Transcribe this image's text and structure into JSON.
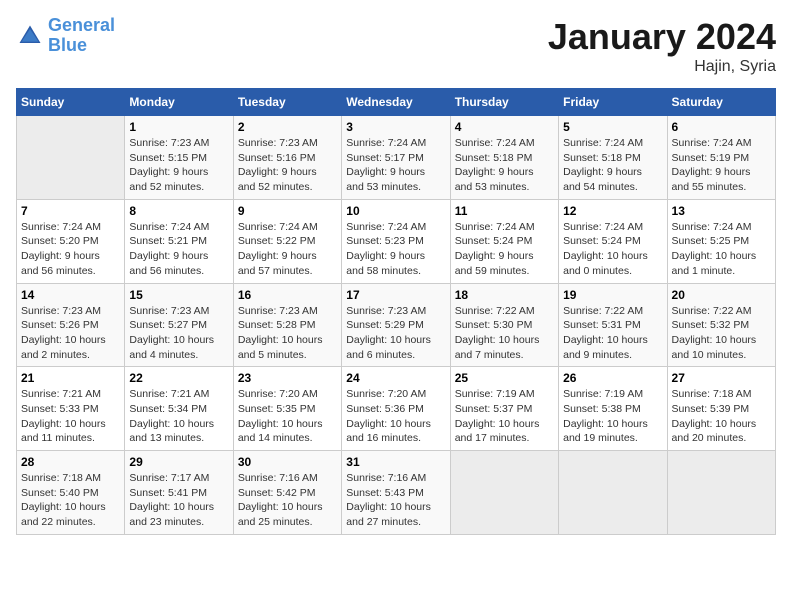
{
  "header": {
    "logo_line1": "General",
    "logo_line2": "Blue",
    "title": "January 2024",
    "subtitle": "Hajin, Syria"
  },
  "columns": [
    "Sunday",
    "Monday",
    "Tuesday",
    "Wednesday",
    "Thursday",
    "Friday",
    "Saturday"
  ],
  "weeks": [
    [
      {
        "day": "",
        "info": ""
      },
      {
        "day": "1",
        "info": "Sunrise: 7:23 AM\nSunset: 5:15 PM\nDaylight: 9 hours\nand 52 minutes."
      },
      {
        "day": "2",
        "info": "Sunrise: 7:23 AM\nSunset: 5:16 PM\nDaylight: 9 hours\nand 52 minutes."
      },
      {
        "day": "3",
        "info": "Sunrise: 7:24 AM\nSunset: 5:17 PM\nDaylight: 9 hours\nand 53 minutes."
      },
      {
        "day": "4",
        "info": "Sunrise: 7:24 AM\nSunset: 5:18 PM\nDaylight: 9 hours\nand 53 minutes."
      },
      {
        "day": "5",
        "info": "Sunrise: 7:24 AM\nSunset: 5:18 PM\nDaylight: 9 hours\nand 54 minutes."
      },
      {
        "day": "6",
        "info": "Sunrise: 7:24 AM\nSunset: 5:19 PM\nDaylight: 9 hours\nand 55 minutes."
      }
    ],
    [
      {
        "day": "7",
        "info": "Sunrise: 7:24 AM\nSunset: 5:20 PM\nDaylight: 9 hours\nand 56 minutes."
      },
      {
        "day": "8",
        "info": "Sunrise: 7:24 AM\nSunset: 5:21 PM\nDaylight: 9 hours\nand 56 minutes."
      },
      {
        "day": "9",
        "info": "Sunrise: 7:24 AM\nSunset: 5:22 PM\nDaylight: 9 hours\nand 57 minutes."
      },
      {
        "day": "10",
        "info": "Sunrise: 7:24 AM\nSunset: 5:23 PM\nDaylight: 9 hours\nand 58 minutes."
      },
      {
        "day": "11",
        "info": "Sunrise: 7:24 AM\nSunset: 5:24 PM\nDaylight: 9 hours\nand 59 minutes."
      },
      {
        "day": "12",
        "info": "Sunrise: 7:24 AM\nSunset: 5:24 PM\nDaylight: 10 hours\nand 0 minutes."
      },
      {
        "day": "13",
        "info": "Sunrise: 7:24 AM\nSunset: 5:25 PM\nDaylight: 10 hours\nand 1 minute."
      }
    ],
    [
      {
        "day": "14",
        "info": "Sunrise: 7:23 AM\nSunset: 5:26 PM\nDaylight: 10 hours\nand 2 minutes."
      },
      {
        "day": "15",
        "info": "Sunrise: 7:23 AM\nSunset: 5:27 PM\nDaylight: 10 hours\nand 4 minutes."
      },
      {
        "day": "16",
        "info": "Sunrise: 7:23 AM\nSunset: 5:28 PM\nDaylight: 10 hours\nand 5 minutes."
      },
      {
        "day": "17",
        "info": "Sunrise: 7:23 AM\nSunset: 5:29 PM\nDaylight: 10 hours\nand 6 minutes."
      },
      {
        "day": "18",
        "info": "Sunrise: 7:22 AM\nSunset: 5:30 PM\nDaylight: 10 hours\nand 7 minutes."
      },
      {
        "day": "19",
        "info": "Sunrise: 7:22 AM\nSunset: 5:31 PM\nDaylight: 10 hours\nand 9 minutes."
      },
      {
        "day": "20",
        "info": "Sunrise: 7:22 AM\nSunset: 5:32 PM\nDaylight: 10 hours\nand 10 minutes."
      }
    ],
    [
      {
        "day": "21",
        "info": "Sunrise: 7:21 AM\nSunset: 5:33 PM\nDaylight: 10 hours\nand 11 minutes."
      },
      {
        "day": "22",
        "info": "Sunrise: 7:21 AM\nSunset: 5:34 PM\nDaylight: 10 hours\nand 13 minutes."
      },
      {
        "day": "23",
        "info": "Sunrise: 7:20 AM\nSunset: 5:35 PM\nDaylight: 10 hours\nand 14 minutes."
      },
      {
        "day": "24",
        "info": "Sunrise: 7:20 AM\nSunset: 5:36 PM\nDaylight: 10 hours\nand 16 minutes."
      },
      {
        "day": "25",
        "info": "Sunrise: 7:19 AM\nSunset: 5:37 PM\nDaylight: 10 hours\nand 17 minutes."
      },
      {
        "day": "26",
        "info": "Sunrise: 7:19 AM\nSunset: 5:38 PM\nDaylight: 10 hours\nand 19 minutes."
      },
      {
        "day": "27",
        "info": "Sunrise: 7:18 AM\nSunset: 5:39 PM\nDaylight: 10 hours\nand 20 minutes."
      }
    ],
    [
      {
        "day": "28",
        "info": "Sunrise: 7:18 AM\nSunset: 5:40 PM\nDaylight: 10 hours\nand 22 minutes."
      },
      {
        "day": "29",
        "info": "Sunrise: 7:17 AM\nSunset: 5:41 PM\nDaylight: 10 hours\nand 23 minutes."
      },
      {
        "day": "30",
        "info": "Sunrise: 7:16 AM\nSunset: 5:42 PM\nDaylight: 10 hours\nand 25 minutes."
      },
      {
        "day": "31",
        "info": "Sunrise: 7:16 AM\nSunset: 5:43 PM\nDaylight: 10 hours\nand 27 minutes."
      },
      {
        "day": "",
        "info": ""
      },
      {
        "day": "",
        "info": ""
      },
      {
        "day": "",
        "info": ""
      }
    ]
  ]
}
